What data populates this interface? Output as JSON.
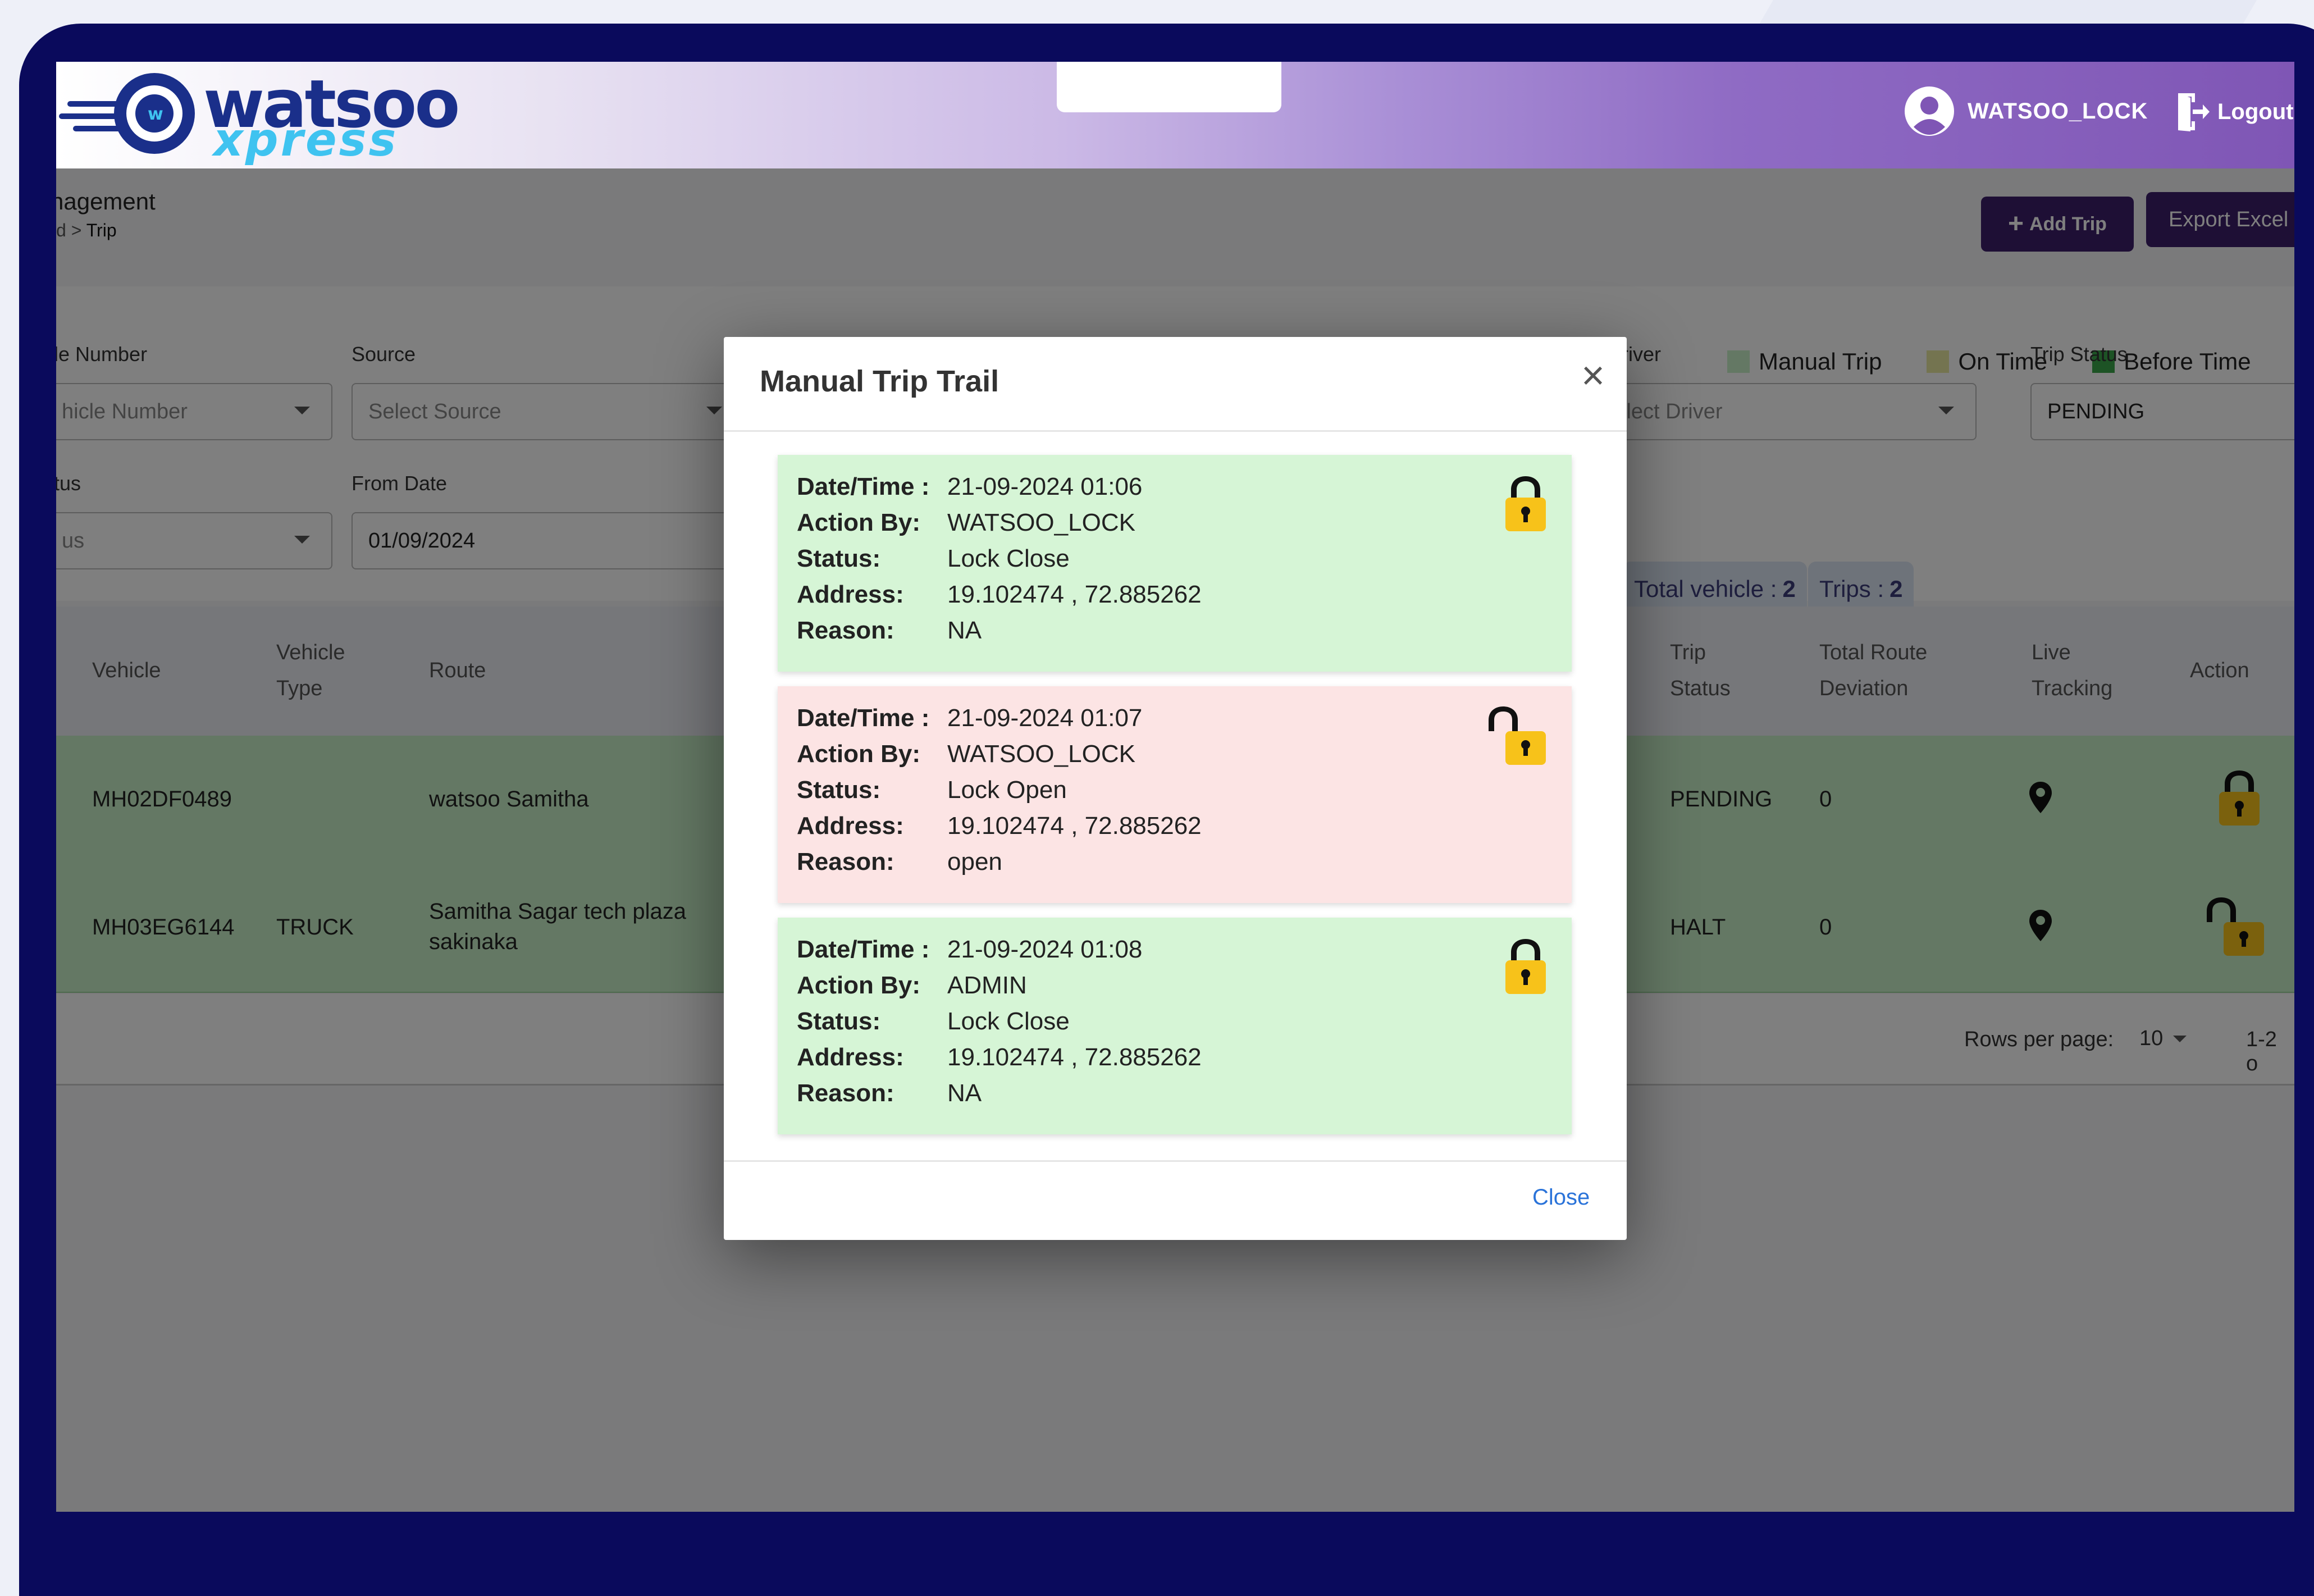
{
  "header": {
    "brand_top": "watsoo",
    "brand_bottom": "xpress",
    "user": "WATSOO_LOCK",
    "logout": "Logout"
  },
  "page": {
    "title": "nagement",
    "breadcrumb_prefix": "d > ",
    "breadcrumb_current": "Trip",
    "add_trip": "Add Trip",
    "export": "Export Excel"
  },
  "legend": [
    {
      "label": "Manual Trip",
      "color": "#c8f0c8"
    },
    {
      "label": "On Time",
      "color": "#e8e8a0"
    },
    {
      "label": "Before Time",
      "color": "#3aa64a"
    }
  ],
  "filters": {
    "vehicle_label": "le Number",
    "vehicle_placeholder": "hicle Number",
    "source_label": "Source",
    "source_placeholder": "Select Source",
    "driver_label": "river",
    "driver_placeholder": "Select Driver",
    "trip_status_label": "Trip Status",
    "trip_status_value": "PENDING",
    "status_label": "tus",
    "status_placeholder": "us",
    "from_date_label": "From Date",
    "from_date_value": "01/09/2024"
  },
  "summary": {
    "total_vehicle_label": "Total vehicle :",
    "total_vehicle": "2",
    "trips_label": "Trips :",
    "trips": "2"
  },
  "table": {
    "headers": {
      "vehicle": "Vehicle",
      "vehicle_type_1": "Vehicle",
      "vehicle_type_2": "Type",
      "route": "Route",
      "trip_status_1": "Trip",
      "trip_status_2": "Status",
      "deviation_1": "Total Route",
      "deviation_2": "Deviation",
      "live_1": "Live",
      "live_2": "Tracking",
      "action": "Action"
    },
    "rows": [
      {
        "vehicle": "MH02DF0489",
        "type": "",
        "route_1": "watsoo Samitha",
        "route_2": "",
        "trip_status": "PENDING",
        "deviation": "0",
        "lock": "closed"
      },
      {
        "vehicle": "MH03EG6144",
        "type": "TRUCK",
        "route_1": "Samitha Sagar tech plaza",
        "route_2": "sakinaka",
        "trip_status": "HALT",
        "deviation": "0",
        "lock": "open"
      }
    ]
  },
  "pagination": {
    "rows_label": "Rows per page:",
    "rows_value": "10",
    "range": "1-2 o"
  },
  "modal": {
    "title": "Manual Trip Trail",
    "close": "Close",
    "labels": {
      "datetime": "Date/Time :",
      "action_by": "Action By:",
      "status": "Status:",
      "address": "Address:",
      "reason": "Reason:"
    },
    "entries": [
      {
        "datetime": "21-09-2024 01:06",
        "action_by": "WATSOO_LOCK",
        "status": "Lock Close",
        "address": "19.102474 , 72.885262",
        "reason": "NA",
        "state": "closed"
      },
      {
        "datetime": "21-09-2024 01:07",
        "action_by": "WATSOO_LOCK",
        "status": "Lock Open",
        "address": "19.102474 , 72.885262",
        "reason": "open",
        "state": "open"
      },
      {
        "datetime": "21-09-2024 01:08",
        "action_by": "ADMIN",
        "status": "Lock Close",
        "address": "19.102474 , 72.885262",
        "reason": "NA",
        "state": "closed"
      }
    ]
  }
}
